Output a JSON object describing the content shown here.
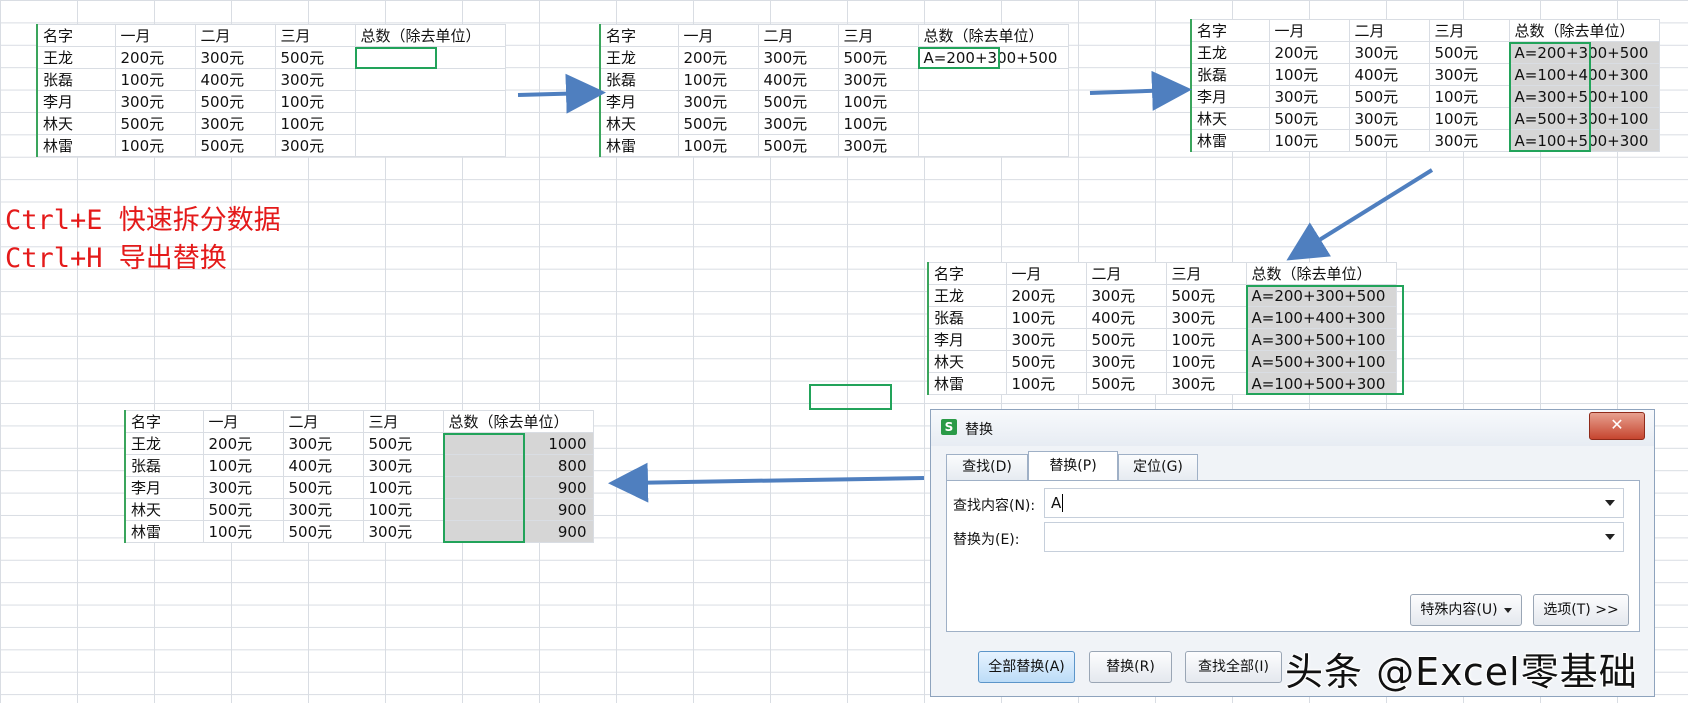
{
  "headers": [
    "名字",
    "一月",
    "二月",
    "三月",
    "总数（除去单位）"
  ],
  "rows": [
    {
      "name": "王龙",
      "jan": "200元",
      "feb": "300元",
      "mar": "500元"
    },
    {
      "name": "张磊",
      "jan": "100元",
      "feb": "400元",
      "mar": "300元"
    },
    {
      "name": "李月",
      "jan": "300元",
      "feb": "500元",
      "mar": "100元"
    },
    {
      "name": "林天",
      "jan": "500元",
      "feb": "300元",
      "mar": "100元"
    },
    {
      "name": "林雷",
      "jan": "100元",
      "feb": "500元",
      "mar": "300元"
    }
  ],
  "step1_totals": [
    "",
    "",
    "",
    "",
    ""
  ],
  "step2_totals": [
    "A=200+300+500",
    "",
    "",
    "",
    ""
  ],
  "step3_totals": [
    "A=200+300+500",
    "A=100+400+300",
    "A=300+500+100",
    "A=500+300+100",
    "A=100+500+300"
  ],
  "step4_totals": [
    "A=200+300+500",
    "A=100+400+300",
    "A=300+500+100",
    "A=500+300+100",
    "A=100+500+300"
  ],
  "step5_totals": [
    "1000",
    "800",
    "900",
    "900",
    "900"
  ],
  "tips": {
    "line1": "Ctrl+E 快速拆分数据",
    "line2": "Ctrl+H 导出替换"
  },
  "colors": {
    "tip_text": "#e41a1a",
    "arrow": "#4f7fbf",
    "selection": "#22a35a"
  },
  "dialog": {
    "title": "替换",
    "close_label": "✕",
    "tabs": [
      "查找(D)",
      "替换(P)",
      "定位(G)"
    ],
    "active_tab": "替换(P)",
    "find_label": "查找内容(N):",
    "find_value": "A",
    "replace_label": "替换为(E):",
    "replace_value": "",
    "special_button": "特殊内容(U)",
    "options_button": "选项(T) >>",
    "replace_all_button": "全部替换(A)",
    "replace_button": "替换(R)",
    "find_all_button": "查找全部(I)"
  },
  "watermark": "头条 @Excel零基础"
}
